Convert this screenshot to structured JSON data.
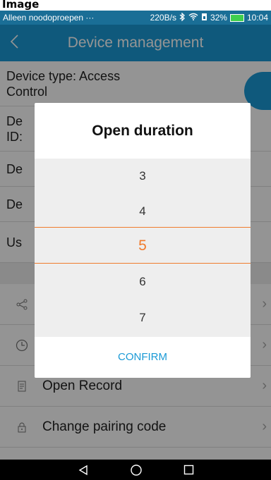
{
  "top_label": "Image",
  "status": {
    "carrier": "Alleen noodoproepen ···",
    "speed": "220B/s",
    "battery": "32%",
    "time": "10:04"
  },
  "header": {
    "title": "Device management",
    "back_icon": "chevron-left-icon"
  },
  "details": {
    "device_type_line1": "Device type: Access",
    "device_type_line2": "Control",
    "row2_line1": "De",
    "row2_line2": "ID:",
    "row3": "De",
    "row4": "De",
    "row5": "Us"
  },
  "menu": [
    {
      "label": "Open Record",
      "icon": "receipt-icon"
    },
    {
      "label": "Change pairing code",
      "icon": "lock-icon"
    }
  ],
  "dialog": {
    "title": "Open duration",
    "options": [
      "3",
      "4",
      "5",
      "6",
      "7"
    ],
    "selected": "5",
    "confirm": "CONFIRM"
  },
  "colors": {
    "accent": "#1a9ad6",
    "selected": "#f07b2d",
    "statusbar": "#1a6e96"
  }
}
